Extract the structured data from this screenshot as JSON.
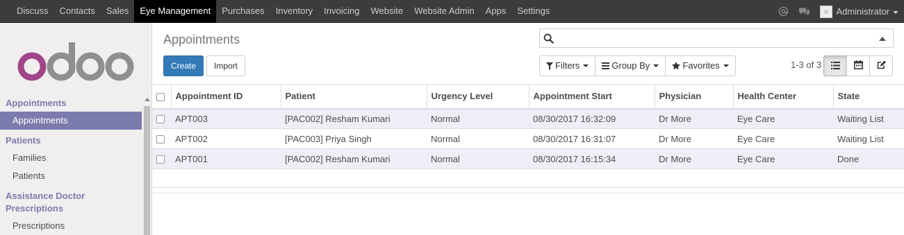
{
  "topbar": {
    "menu": [
      "Discuss",
      "Contacts",
      "Sales",
      "Eye Management",
      "Purchases",
      "Inventory",
      "Invoicing",
      "Website",
      "Website Admin",
      "Apps",
      "Settings"
    ],
    "active_index": 3,
    "user": "Administrator",
    "icons": [
      "at-icon",
      "chat-icon"
    ]
  },
  "sidebar": {
    "logo_text": "odoo",
    "sections": [
      {
        "title": "Appointments",
        "items": [
          "Appointments"
        ]
      },
      {
        "title": "Patients",
        "items": [
          "Families",
          "Patients"
        ]
      },
      {
        "title": "Assistance Doctor Prescriptions",
        "items": [
          "Prescriptions"
        ]
      }
    ],
    "active_item": "Appointments"
  },
  "control_panel": {
    "title": "Appointments",
    "create_label": "Create",
    "import_label": "Import",
    "search": {
      "value": "",
      "placeholder": ""
    },
    "filters_label": "Filters",
    "groupby_label": "Group By",
    "favorites_label": "Favorites",
    "pager": "1-3 of 3",
    "views": [
      "list-view",
      "calendar-view",
      "form-view"
    ],
    "active_view": "list-view"
  },
  "table": {
    "columns": [
      "Appointment ID",
      "Patient",
      "Urgency Level",
      "Appointment Start",
      "Physician",
      "Health Center",
      "State"
    ],
    "rows": [
      [
        "APT003",
        "[PAC002] Resham Kumari",
        "Normal",
        "08/30/2017 16:32:09",
        "Dr More",
        "Eye Care",
        "Waiting List"
      ],
      [
        "APT002",
        "[PAC003] Priya Singh",
        "Normal",
        "08/30/2017 16:31:07",
        "Dr More",
        "Eye Care",
        "Waiting List"
      ],
      [
        "APT001",
        "[PAC002] Resham Kumari",
        "Normal",
        "08/30/2017 16:15:34",
        "Dr More",
        "Eye Care",
        "Done"
      ]
    ]
  },
  "colors": {
    "topbar": "#3c3c3c",
    "accent": "#7c7bad",
    "primary_button": "#337ab7",
    "odd_row": "#eeeef6"
  }
}
